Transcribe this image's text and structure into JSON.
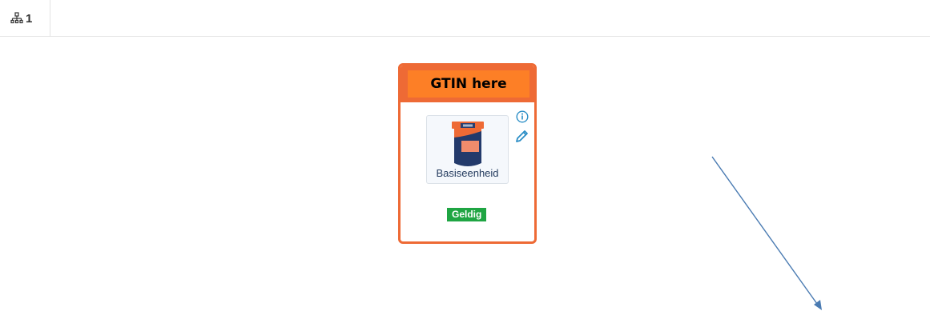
{
  "tabs": [
    {
      "icon": "hierarchy-icon",
      "count": "1"
    }
  ],
  "card": {
    "gtin_label": "GTIN here",
    "unit_label": "Basiseenheid",
    "unit_icon": "base-unit-icon",
    "status": "Geldig",
    "colors": {
      "border": "#ee6a35",
      "gtin_background": "#fd7f26",
      "status": "#1fa543",
      "icon_accent": "#2b8ec6"
    },
    "actions": [
      "info-icon",
      "edit-icon"
    ]
  },
  "annotation": {
    "type": "arrow",
    "color": "#4a7bb2"
  }
}
